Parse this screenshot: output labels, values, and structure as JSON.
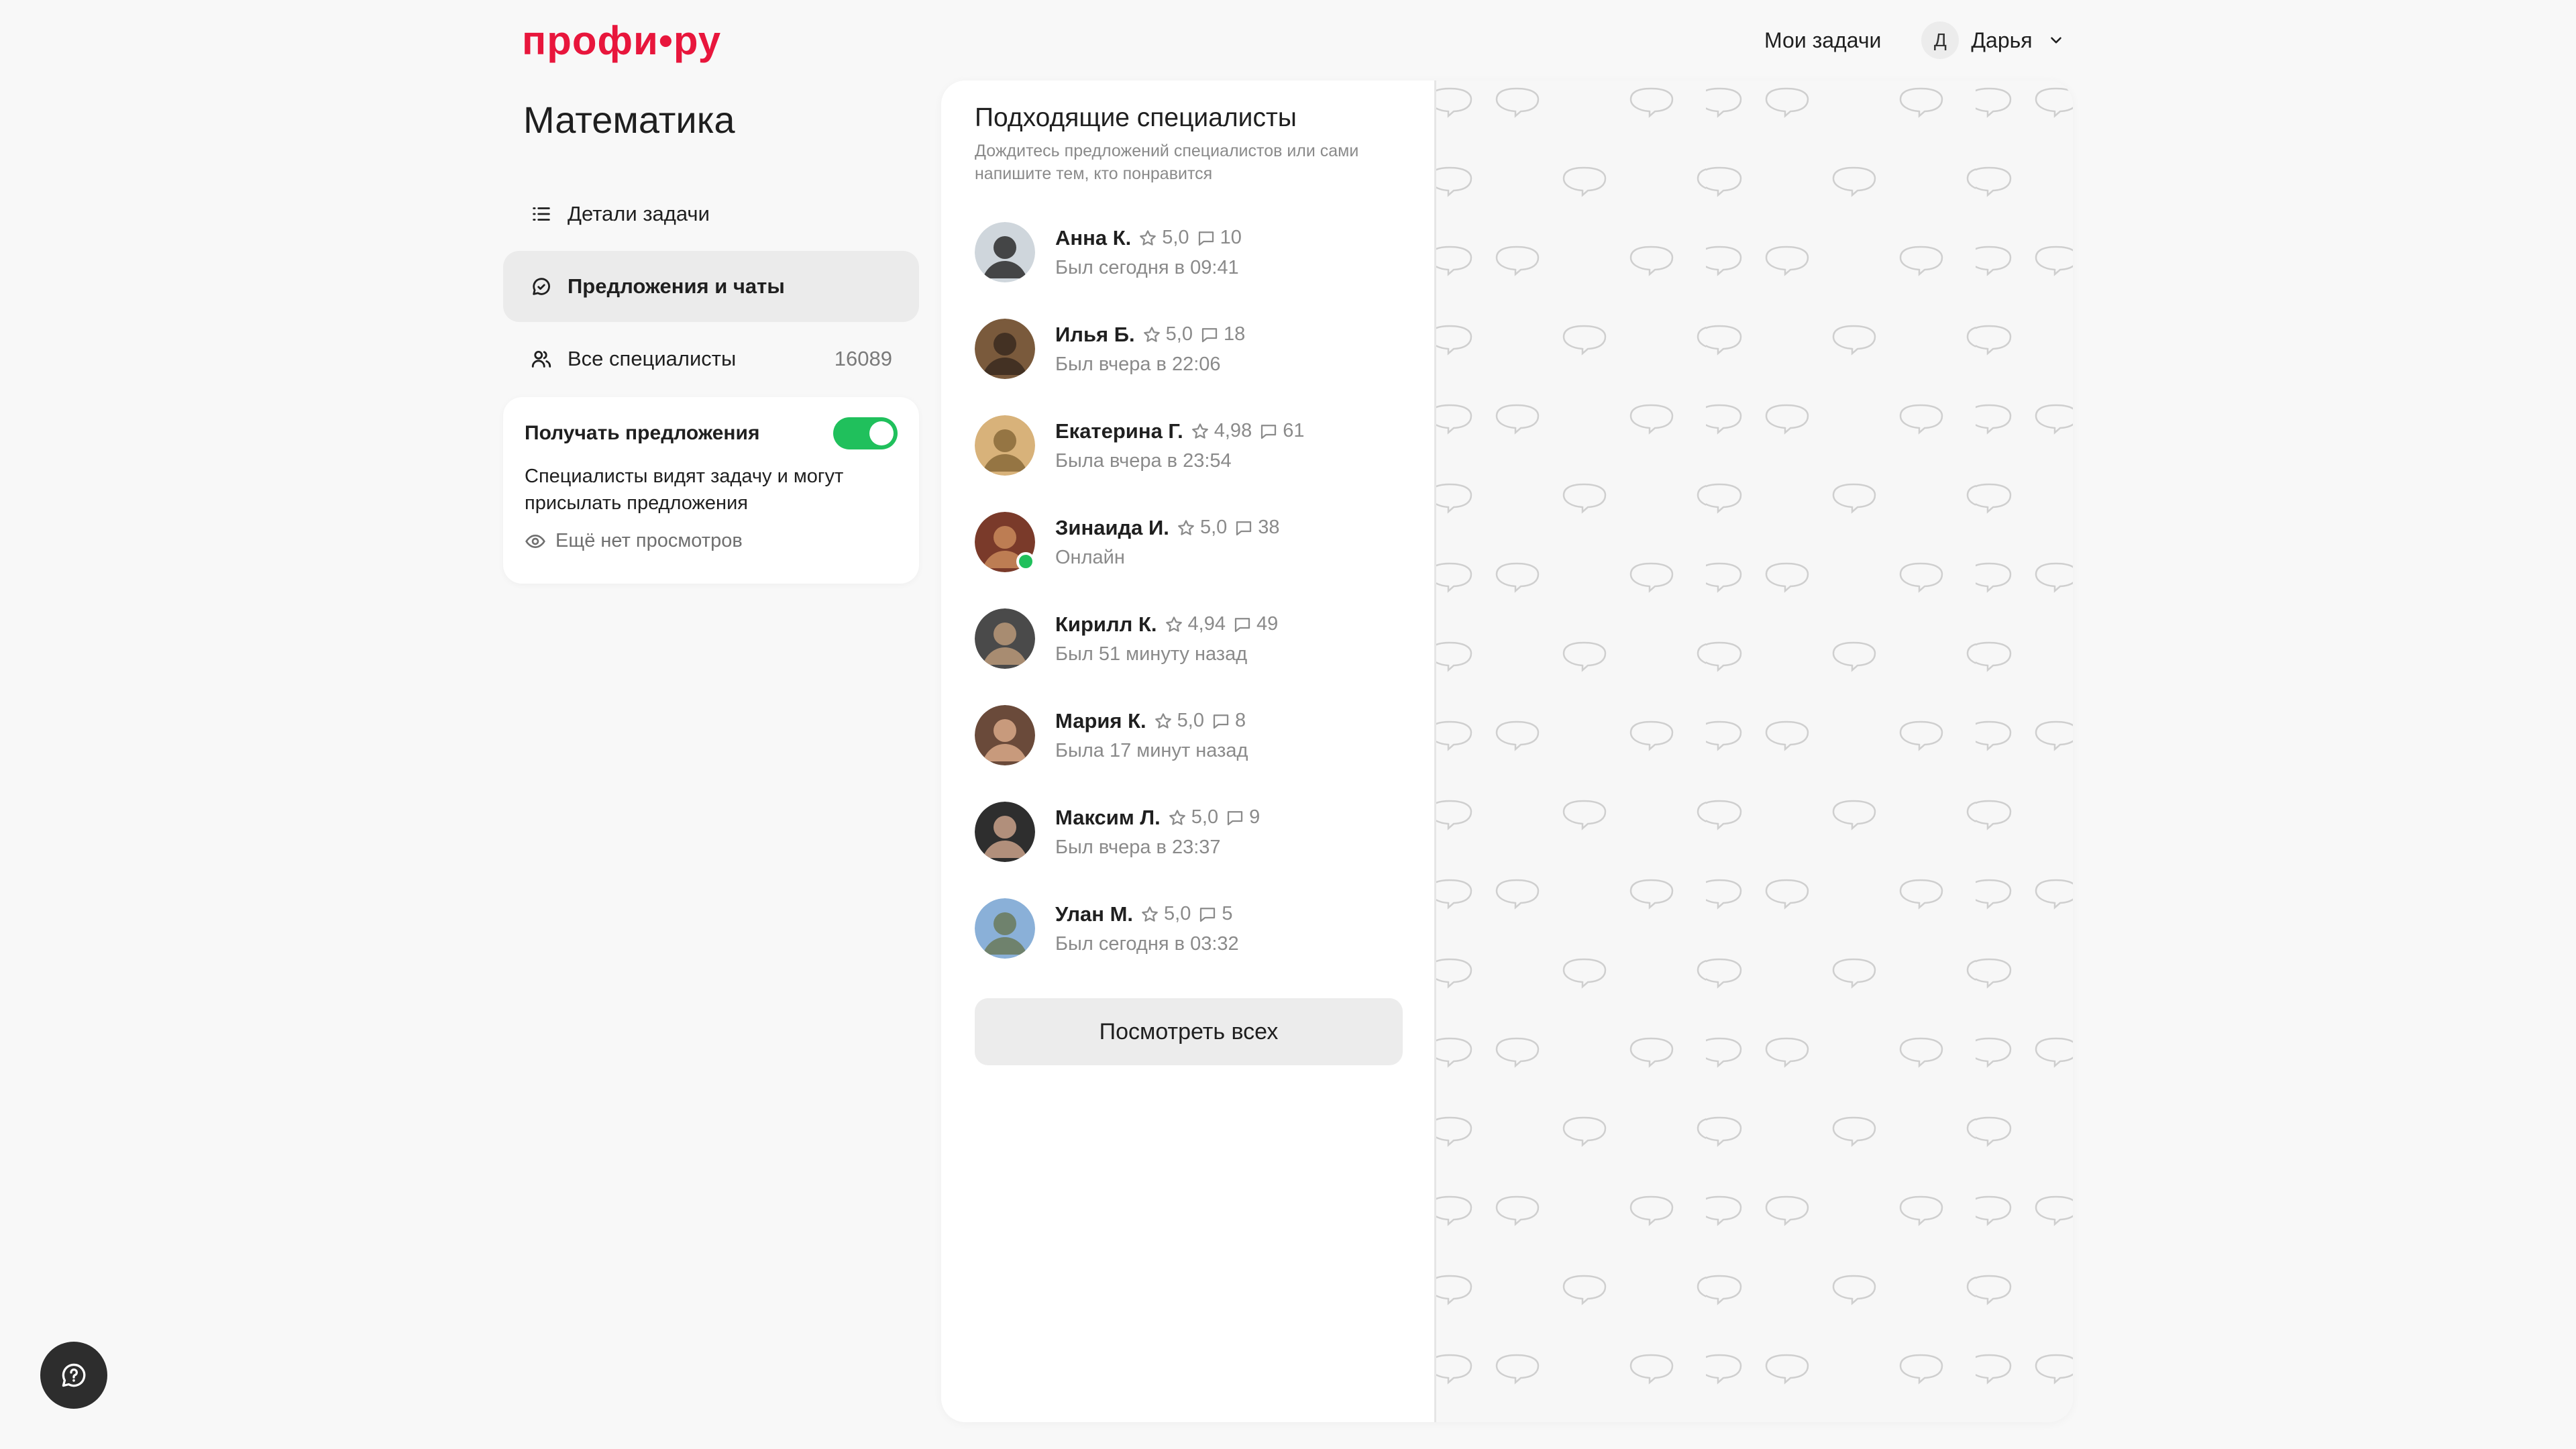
{
  "brand": {
    "logo_text": "профи•ру",
    "accent": "#e8163c"
  },
  "header": {
    "my_tasks": "Мои задачи",
    "user_initial": "Д",
    "user_name": "Дарья"
  },
  "page": {
    "title": "Математика"
  },
  "sidebar": {
    "items": [
      {
        "label": "Детали задачи",
        "icon": "list-icon"
      },
      {
        "label": "Предложения и чаты",
        "icon": "chat-icon",
        "active": true
      },
      {
        "label": "Все специалисты",
        "icon": "users-icon",
        "count": "16089"
      }
    ]
  },
  "receive_offers": {
    "title": "Получать предложения",
    "enabled": true,
    "description": "Специалисты видят задачу и могут присылать предложения",
    "views": "Ещё нет просмотров"
  },
  "specialists": {
    "title": "Подходящие специалисты",
    "subtitle": "Дождитесь предложений специалистов или сами напишите тем, кто понравится",
    "items": [
      {
        "name": "Анна К.",
        "rating": "5,0",
        "reviews": "10",
        "status": "Был сегодня в 09:41",
        "online": false
      },
      {
        "name": "Илья Б.",
        "rating": "5,0",
        "reviews": "18",
        "status": "Был вчера в 22:06",
        "online": false
      },
      {
        "name": "Екатерина Г.",
        "rating": "4,98",
        "reviews": "61",
        "status": "Была вчера в 23:54",
        "online": false
      },
      {
        "name": "Зинаида И.",
        "rating": "5,0",
        "reviews": "38",
        "status": "Онлайн",
        "online": true
      },
      {
        "name": "Кирилл К.",
        "rating": "4,94",
        "reviews": "49",
        "status": "Был 51 минуту назад",
        "online": false
      },
      {
        "name": "Мария К.",
        "rating": "5,0",
        "reviews": "8",
        "status": "Была 17 минут назад",
        "online": false
      },
      {
        "name": "Максим Л.",
        "rating": "5,0",
        "reviews": "9",
        "status": "Был вчера в 23:37",
        "online": false
      },
      {
        "name": "Улан М.",
        "rating": "5,0",
        "reviews": "5",
        "status": "Был сегодня в 03:32",
        "online": false
      }
    ],
    "view_all": "Посмотреть всех"
  },
  "colors": {
    "online": "#20c05c",
    "toggle_on": "#20c05c"
  }
}
